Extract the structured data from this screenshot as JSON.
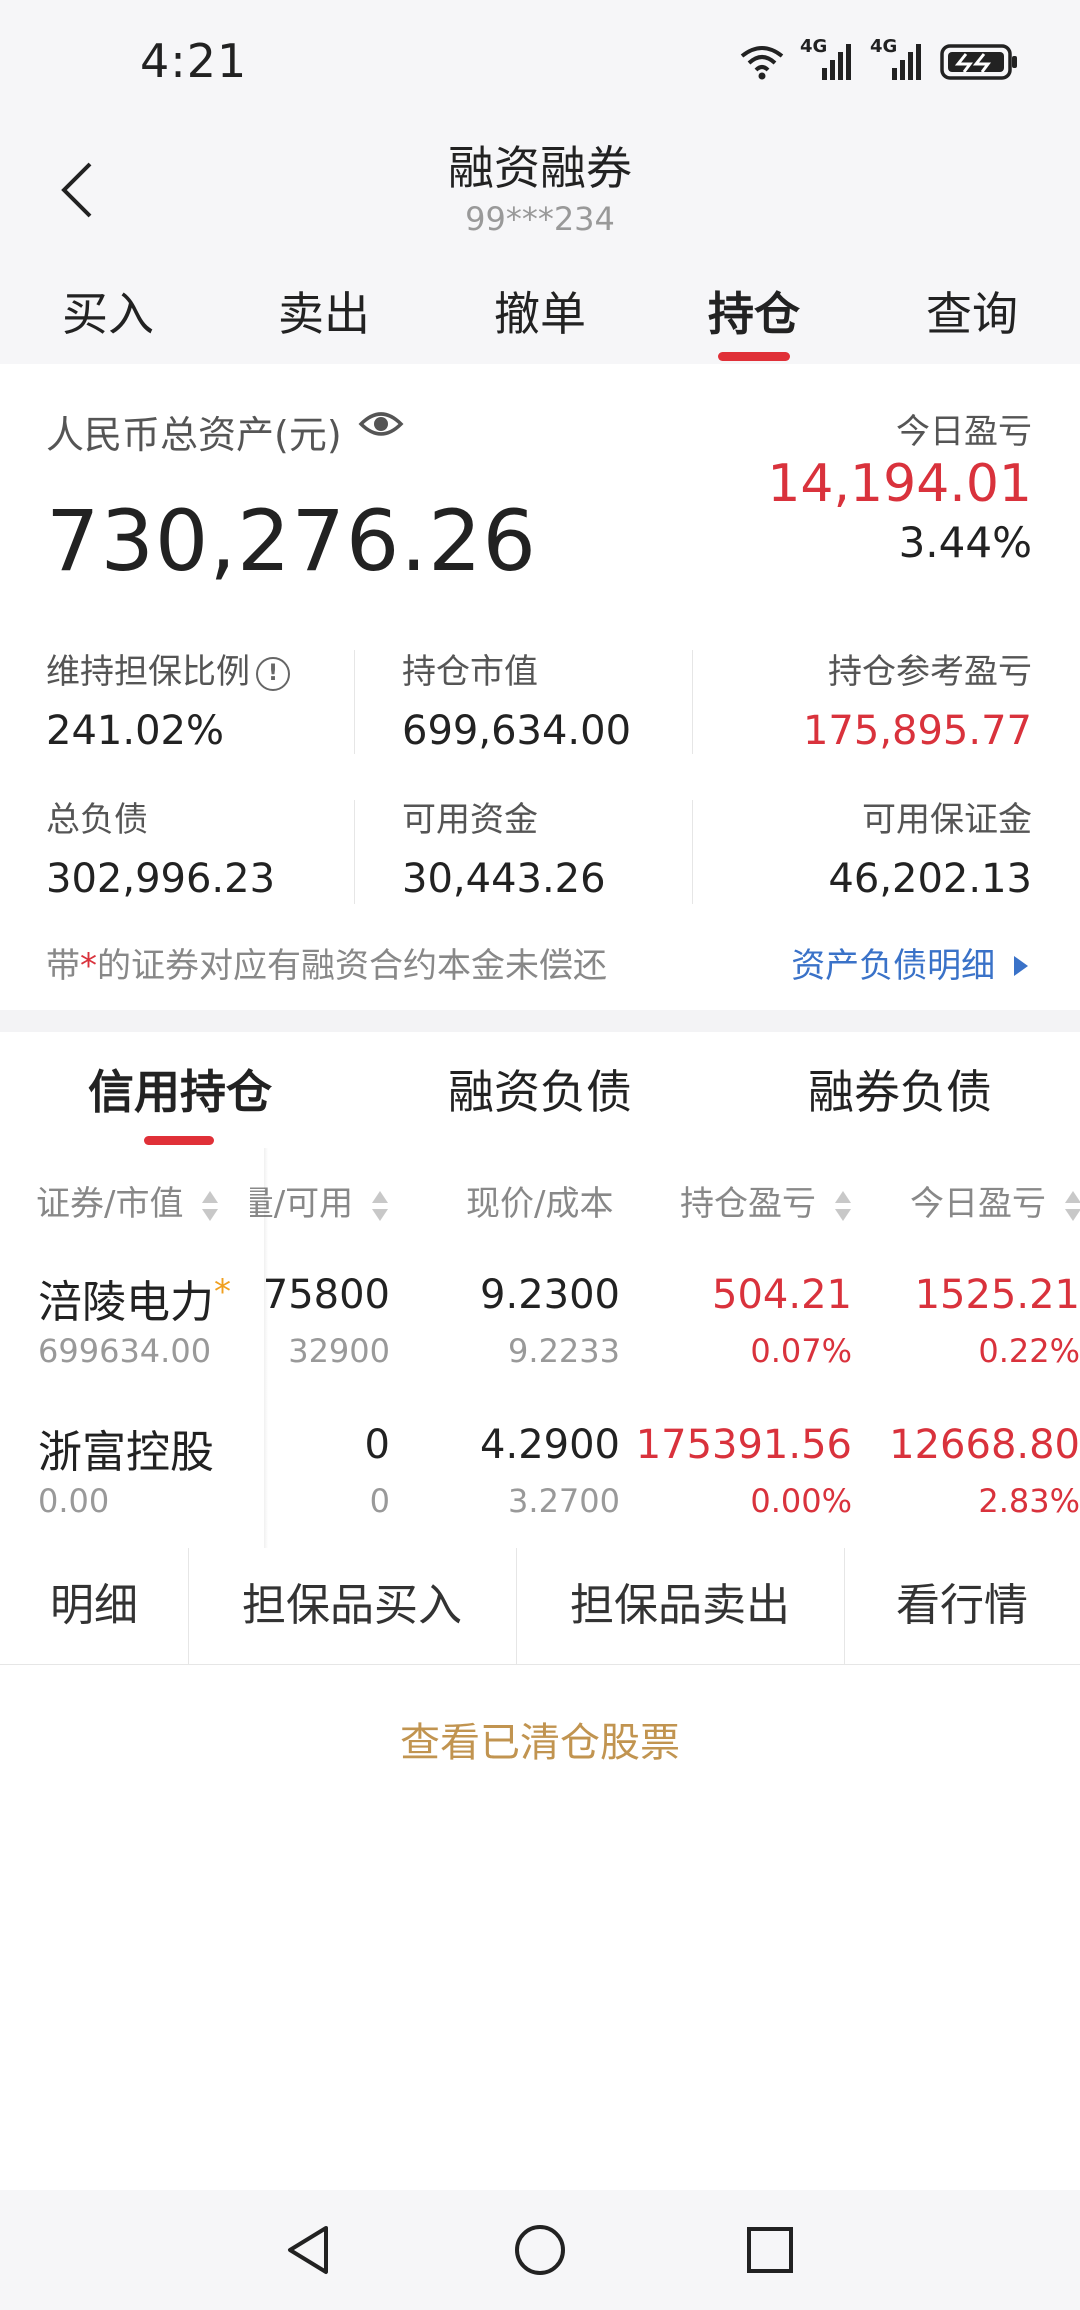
{
  "status_bar": {
    "time": "4:21",
    "network1": "4G",
    "network2": "4G"
  },
  "header": {
    "title": "融资融券",
    "account": "99***234"
  },
  "tabs": [
    {
      "label": "买入"
    },
    {
      "label": "卖出"
    },
    {
      "label": "撤单"
    },
    {
      "label": "持仓",
      "active": true
    },
    {
      "label": "查询"
    }
  ],
  "summary": {
    "total_label": "人民币总资产(元)",
    "total_value": "730,276.26",
    "today_label": "今日盈亏",
    "today_value": "14,194.01",
    "today_pct": "3.44%",
    "metrics": [
      {
        "label": "维持担保比例",
        "value": "241.02%"
      },
      {
        "label": "持仓市值",
        "value": "699,634.00"
      },
      {
        "label": "持仓参考盈亏",
        "value": "175,895.77"
      },
      {
        "label": "总负债",
        "value": "302,996.23"
      },
      {
        "label": "可用资金",
        "value": "30,443.26"
      },
      {
        "label": "可用保证金",
        "value": "46,202.13"
      }
    ],
    "note_prefix": "带",
    "note_star": "*",
    "note_suffix": "的证券对应有融资合约本金未偿还",
    "detail_link": "资产负债明细"
  },
  "sub_tabs": [
    {
      "label": "信用持仓",
      "active": true
    },
    {
      "label": "融资负债"
    },
    {
      "label": "融券负债"
    }
  ],
  "table": {
    "headers": [
      "证券/市值",
      "量/可用",
      "现价/成本",
      "持仓盈亏",
      "今日盈亏"
    ],
    "rows": [
      {
        "name": "涪陵电力",
        "star": "*",
        "market_value": "699634.00",
        "qty": "75800",
        "available": "32900",
        "price": "9.2300",
        "cost": "9.2233",
        "pnl": "504.21",
        "pnl_pct": "0.07%",
        "today_pnl": "1525.21",
        "today_pct": "0.22%"
      },
      {
        "name": "浙富控股",
        "star": "",
        "market_value": "0.00",
        "qty": "0",
        "available": "0",
        "price": "4.2900",
        "cost": "3.2700",
        "pnl": "175391.56",
        "pnl_pct": "0.00%",
        "today_pnl": "12668.80",
        "today_pct": "2.83%"
      }
    ]
  },
  "actions": [
    "明细",
    "担保品买入",
    "担保品卖出",
    "看行情"
  ],
  "cleared_link": "查看已清仓股票",
  "colors": {
    "accent_red": "#d9323c",
    "link_blue": "#3a72c8",
    "gold": "#c19450"
  }
}
